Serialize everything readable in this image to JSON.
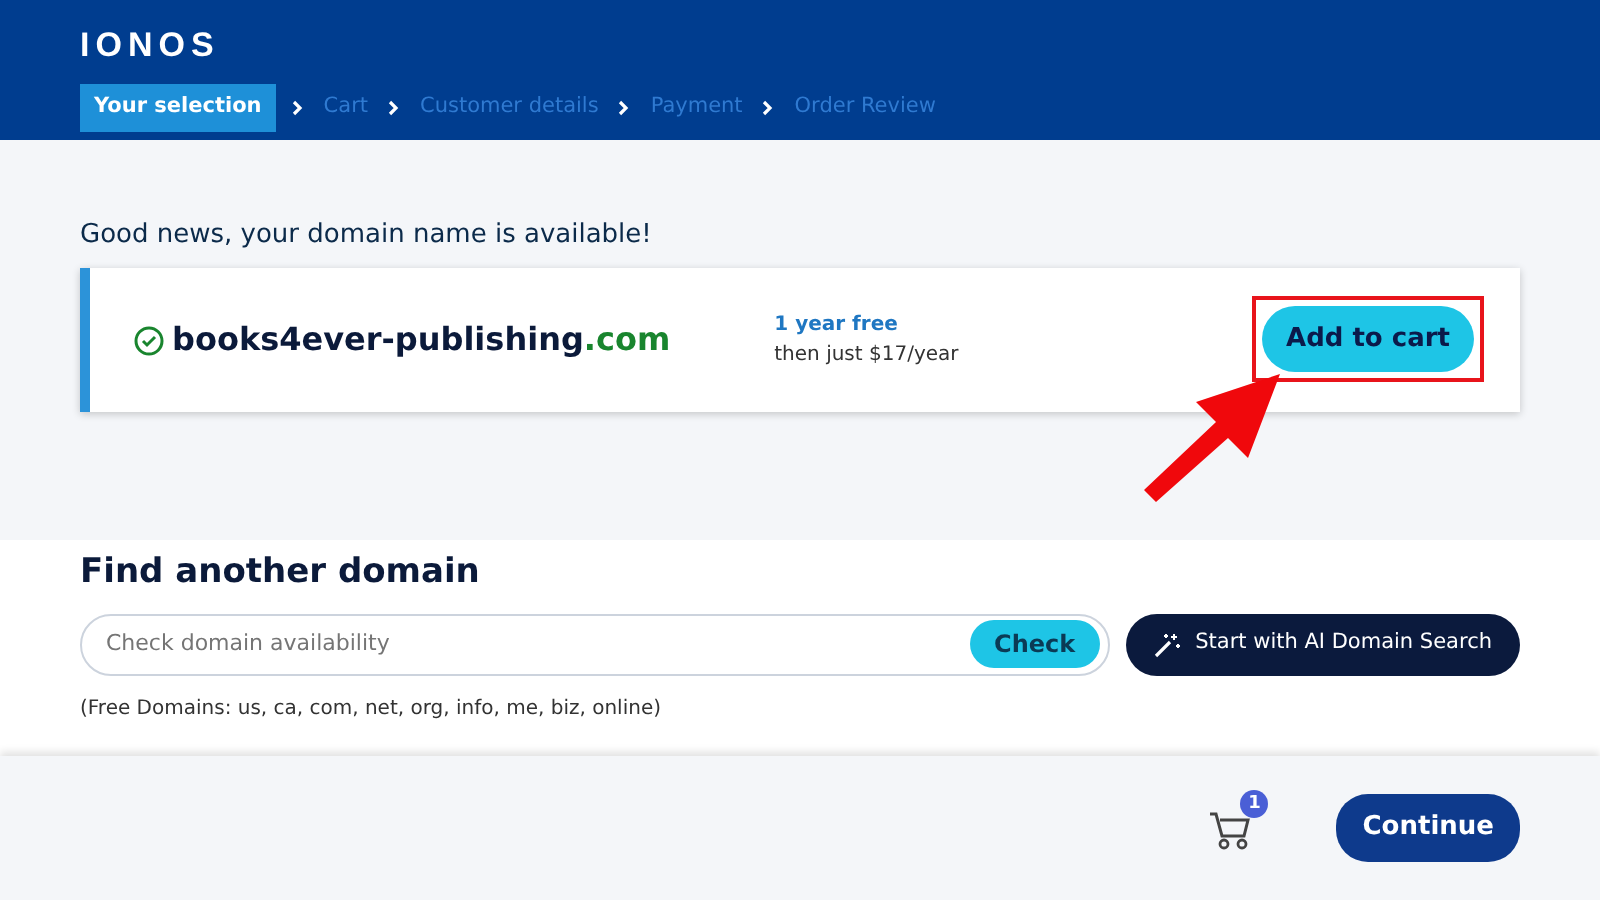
{
  "header": {
    "logo": "IONOS",
    "steps": [
      {
        "label": "Your selection",
        "selected": true
      },
      {
        "label": "Cart",
        "selected": false
      },
      {
        "label": "Customer details",
        "selected": false
      },
      {
        "label": "Payment",
        "selected": false
      },
      {
        "label": "Order Review",
        "selected": false
      }
    ]
  },
  "result": {
    "message": "Good news, your domain name is available!",
    "available": true,
    "domain": {
      "name": "books4ever-publishing",
      "tld": ".com"
    },
    "offer": "1 year free",
    "price": "then just $17/year",
    "button": "Add to cart",
    "highlighted": true
  },
  "search": {
    "title": "Find another domain",
    "placeholder": "Check domain availability",
    "check_button": "Check",
    "ai_button": "Start with AI Domain Search",
    "note": "(Free Domains: us, ca, com, net, org, info, me, biz, online)"
  },
  "footer": {
    "cart_count": "1",
    "continue_button": "Continue"
  }
}
